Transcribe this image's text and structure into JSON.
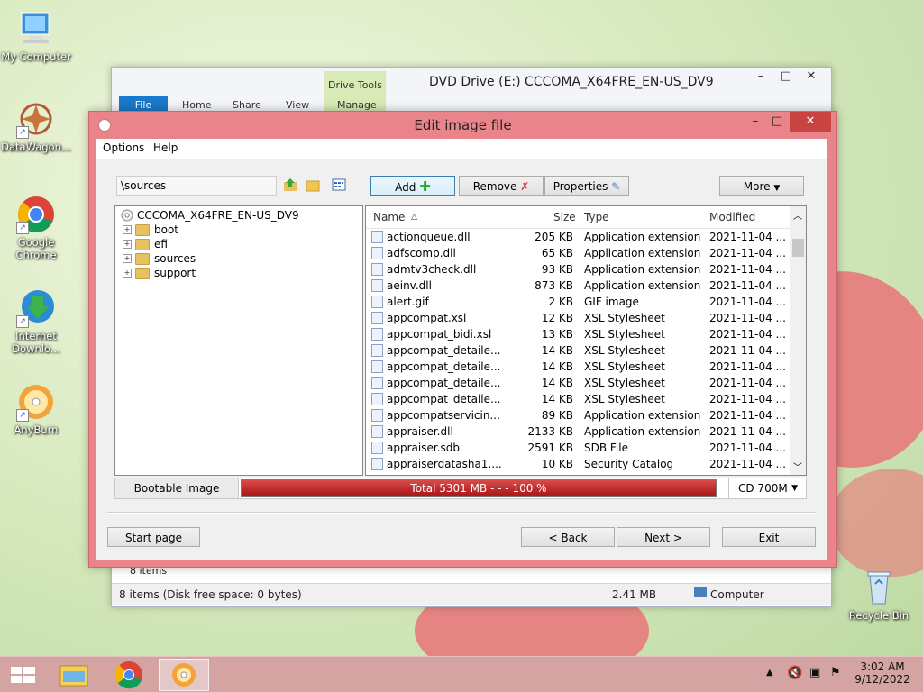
{
  "desktop": {
    "icons": [
      {
        "label": "My Computer"
      },
      {
        "label": "DataWagon..."
      },
      {
        "label": "Google Chrome"
      },
      {
        "label": "Internet Downlo..."
      },
      {
        "label": "AnyBurn"
      },
      {
        "label": "Recycle Bin"
      }
    ]
  },
  "explorer": {
    "title": "DVD Drive (E:) CCCOMA_X64FRE_EN-US_DV9",
    "drive_tools": "Drive Tools",
    "tabs": [
      "File",
      "Home",
      "Share",
      "View",
      "Manage"
    ],
    "item_count": "8 items",
    "status_left": "8 items (Disk free space: 0 bytes)",
    "status_size": "2.41 MB",
    "status_location": "Computer"
  },
  "dialog": {
    "title": "Edit image file",
    "menu": [
      "Options",
      "Help"
    ],
    "path": "\\sources",
    "buttons": {
      "add": "Add",
      "remove": "Remove",
      "properties": "Properties",
      "more": "More"
    },
    "tree": {
      "root": "CCCOMA_X64FRE_EN-US_DV9",
      "children": [
        "boot",
        "efi",
        "sources",
        "support"
      ]
    },
    "columns": [
      "Name",
      "Size",
      "Type",
      "Modified"
    ],
    "files": [
      {
        "name": "actionqueue.dll",
        "size": "205 KB",
        "type": "Application extension",
        "modified": "2021-11-04 ..."
      },
      {
        "name": "adfscomp.dll",
        "size": "65 KB",
        "type": "Application extension",
        "modified": "2021-11-04 ..."
      },
      {
        "name": "admtv3check.dll",
        "size": "93 KB",
        "type": "Application extension",
        "modified": "2021-11-04 ..."
      },
      {
        "name": "aeinv.dll",
        "size": "873 KB",
        "type": "Application extension",
        "modified": "2021-11-04 ..."
      },
      {
        "name": "alert.gif",
        "size": "2 KB",
        "type": "GIF image",
        "modified": "2021-11-04 ..."
      },
      {
        "name": "appcompat.xsl",
        "size": "12 KB",
        "type": "XSL Stylesheet",
        "modified": "2021-11-04 ..."
      },
      {
        "name": "appcompat_bidi.xsl",
        "size": "13 KB",
        "type": "XSL Stylesheet",
        "modified": "2021-11-04 ..."
      },
      {
        "name": "appcompat_detaile...",
        "size": "14 KB",
        "type": "XSL Stylesheet",
        "modified": "2021-11-04 ..."
      },
      {
        "name": "appcompat_detaile...",
        "size": "14 KB",
        "type": "XSL Stylesheet",
        "modified": "2021-11-04 ..."
      },
      {
        "name": "appcompat_detaile...",
        "size": "14 KB",
        "type": "XSL Stylesheet",
        "modified": "2021-11-04 ..."
      },
      {
        "name": "appcompat_detaile...",
        "size": "14 KB",
        "type": "XSL Stylesheet",
        "modified": "2021-11-04 ..."
      },
      {
        "name": "appcompatservicin...",
        "size": "89 KB",
        "type": "Application extension",
        "modified": "2021-11-04 ..."
      },
      {
        "name": "appraiser.dll",
        "size": "2133 KB",
        "type": "Application extension",
        "modified": "2021-11-04 ..."
      },
      {
        "name": "appraiser.sdb",
        "size": "2591 KB",
        "type": "SDB File",
        "modified": "2021-11-04 ..."
      },
      {
        "name": "appraiserdatasha1....",
        "size": "10 KB",
        "type": "Security Catalog",
        "modified": "2021-11-04 ..."
      }
    ],
    "bootable_label": "Bootable Image",
    "progress": {
      "text": "Total  5301 MB   - - -  100 %",
      "fraction": 1.0
    },
    "media": "CD 700M",
    "nav": {
      "start": "Start page",
      "back": "< Back",
      "next": "Next >",
      "exit": "Exit"
    }
  },
  "taskbar": {
    "time": "3:02 AM",
    "date": "9/12/2022"
  }
}
